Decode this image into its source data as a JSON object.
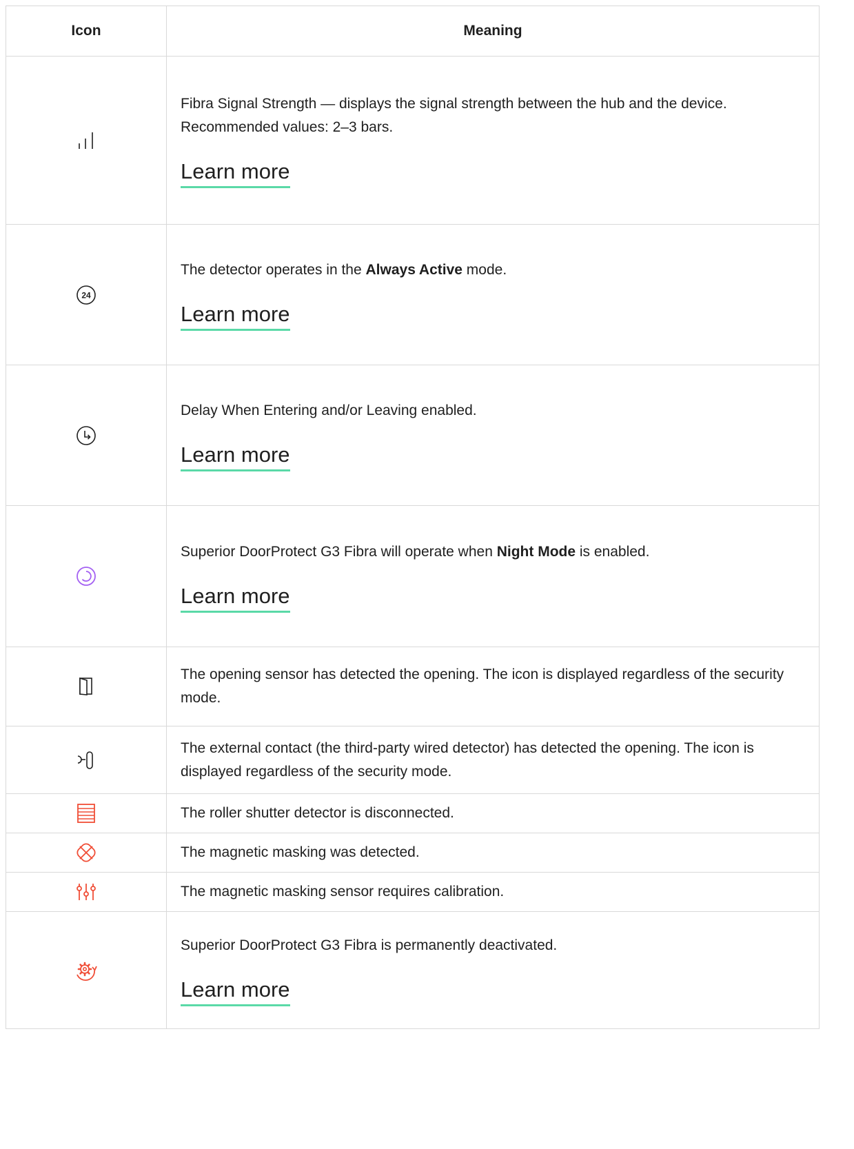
{
  "table": {
    "headers": {
      "icon": "Icon",
      "meaning": "Meaning"
    },
    "learn_more_label": "Learn more",
    "rows": [
      {
        "icon": "signal-strength-icon",
        "text": "Fibra Signal Strength — displays the signal strength between the hub and the device. Recommended values: 2–3 bars.",
        "has_link": true
      },
      {
        "icon": "always-active-24-icon",
        "text_before": "The detector operates in the ",
        "bold": "Always Active",
        "text_after": " mode.",
        "has_link": true
      },
      {
        "icon": "delay-clock-icon",
        "text": "Delay When Entering and/or Leaving enabled.",
        "has_link": true
      },
      {
        "icon": "night-mode-icon",
        "icon_color": "#a461f2",
        "text_before": "Superior DoorProtect G3 Fibra will operate when ",
        "bold": "Night Mode",
        "text_after": " is enabled.",
        "has_link": true
      },
      {
        "icon": "door-open-icon",
        "text": "The opening sensor has detected the opening. The icon is displayed regardless of the security mode.",
        "has_link": false
      },
      {
        "icon": "external-contact-icon",
        "text": "The external contact (the third-party wired detector) has detected the opening. The icon is displayed regardless of the security mode.",
        "has_link": false
      },
      {
        "icon": "roller-shutter-icon",
        "icon_color": "#f04e37",
        "text": "The roller shutter detector is disconnected.",
        "has_link": false
      },
      {
        "icon": "magnetic-masking-icon",
        "icon_color": "#f04e37",
        "text": "The magnetic masking was detected.",
        "has_link": false
      },
      {
        "icon": "calibration-sliders-icon",
        "icon_color": "#f04e37",
        "text": "The magnetic masking sensor requires calibration.",
        "has_link": false
      },
      {
        "icon": "permanently-deactivated-icon",
        "icon_color": "#f04e37",
        "text": "Superior DoorProtect G3 Fibra is permanently deactivated.",
        "has_link": true
      }
    ]
  },
  "colors": {
    "link_underline": "#5ad9a7",
    "alert": "#f04e37",
    "night": "#a461f2",
    "border": "#d9d9d9"
  }
}
